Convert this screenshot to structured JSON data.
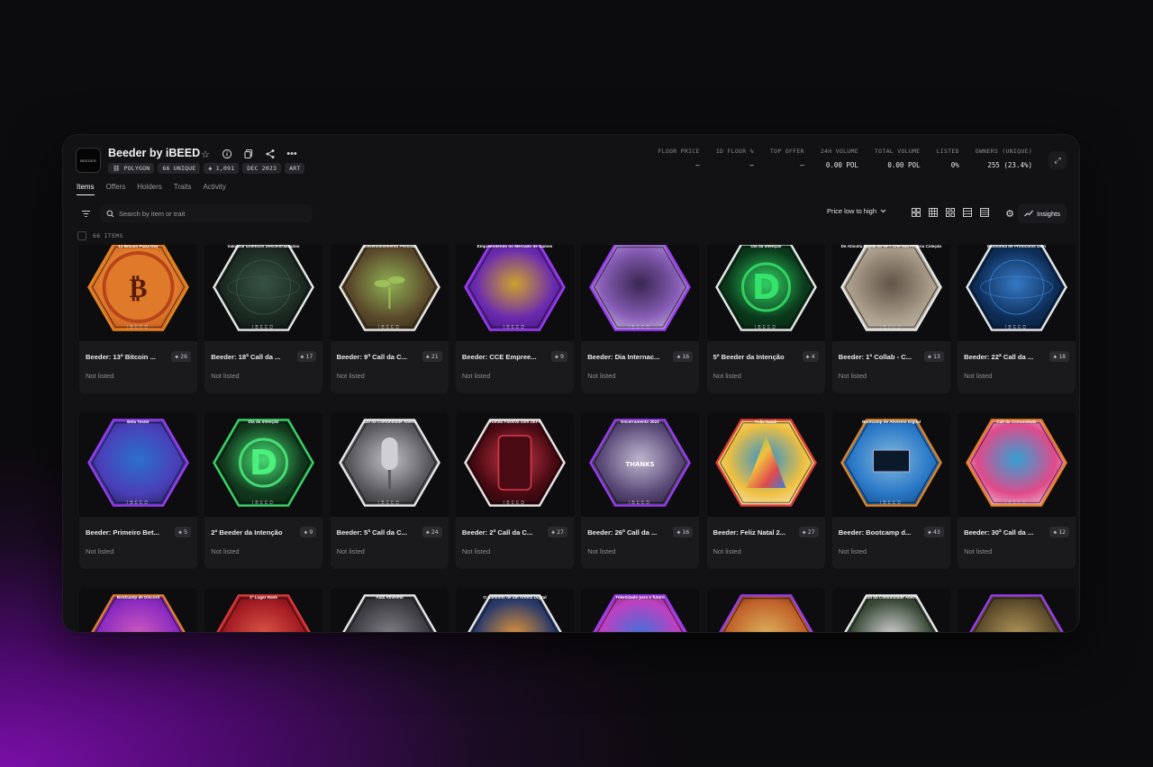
{
  "collection": {
    "logo_text": "BEEDER",
    "name": "Beeder by iBEED",
    "badges": [
      "POLYGON",
      "66 UNIQUE",
      "1,091",
      "DEC 2023",
      "ART"
    ]
  },
  "stats": [
    {
      "label": "FLOOR PRICE",
      "value": "–"
    },
    {
      "label": "1D FLOOR %",
      "value": "–"
    },
    {
      "label": "TOP OFFER",
      "value": "–"
    },
    {
      "label": "24H VOLUME",
      "value": "0.00 POL"
    },
    {
      "label": "TOTAL VOLUME",
      "value": "0.00 POL"
    },
    {
      "label": "LISTED",
      "value": "0%"
    },
    {
      "label": "OWNERS (UNIQUE)",
      "value": "255 (23.4%)"
    }
  ],
  "tabs": [
    "Items",
    "Offers",
    "Holders",
    "Traits",
    "Activity"
  ],
  "search": {
    "placeholder": "Search by item or trait"
  },
  "sort": {
    "label": "Price low to high"
  },
  "insights_label": "Insights",
  "items_count": "66 ITEMS",
  "colors": {
    "accent_purple": "#8a1cc7",
    "card_bg": "#1a1a1d",
    "window_bg": "#121214"
  },
  "items": [
    {
      "name": "Beeder: 13º Bitcoin ...",
      "qty": "26",
      "status": "Not listed",
      "hex_title": "13 Bitcoin Pizza Day",
      "hex_color": "#e3841e",
      "art": "pizza"
    },
    {
      "name": "Beeder: 18ª Call da ...",
      "qty": "17",
      "status": "Not listed",
      "hex_title": "Valorizar Estéticos Descentralizados",
      "hex_color": "#e8e8e8",
      "art": "atom"
    },
    {
      "name": "Beeder: 9ª Call da C...",
      "qty": "21",
      "status": "Not listed",
      "hex_title": "Desenvolvimento Pessoal",
      "hex_color": "#e8e8e8",
      "art": "sprout"
    },
    {
      "name": "Beeder: CCE Empree...",
      "qty": "9",
      "status": "Not listed",
      "hex_title": "Empreendendo no Mercado de Games",
      "hex_color": "#9a3cf0",
      "art": "games"
    },
    {
      "name": "Beeder: Dia Internac...",
      "qty": "16",
      "status": "Not listed",
      "hex_title": "",
      "hex_color": "#9a3cf0",
      "art": "flowers"
    },
    {
      "name": "5º Beeder da Intenção",
      "qty": "4",
      "status": "Not listed",
      "hex_title": "Dia da Intenção",
      "hex_color": "#e8e8e8",
      "art": "dgreen"
    },
    {
      "name": "Beeder: 1º Collab - C...",
      "qty": "13",
      "status": "Not listed",
      "hex_title": "De Ativista Digital ao NFT Crie sua Própria Coleção",
      "hex_color": "#e8e8e8",
      "art": "papers"
    },
    {
      "name": "Beeder: 22ª Call da ...",
      "qty": "18",
      "status": "Not listed",
      "hex_title": "Economia de Protocolos DeFi",
      "hex_color": "#e8e8e8",
      "art": "network"
    },
    {
      "name": "Beeder: Primeiro Bet...",
      "qty": "5",
      "status": "Not listed",
      "hex_title": "Beta Tester",
      "hex_color": "#9a3cf0",
      "art": "avatar"
    },
    {
      "name": "2º Beeder da Intenção",
      "qty": "9",
      "status": "Not listed",
      "hex_title": "Dia da Intenção",
      "hex_color": "#3ad46a",
      "art": "dgreen2"
    },
    {
      "name": "Beeder: 5ª Call da C...",
      "qty": "24",
      "status": "Not listed",
      "hex_title": "Call da Comunidade Aberta",
      "hex_color": "#e8e8e8",
      "art": "mic"
    },
    {
      "name": "Beeder: 2ª Call da C...",
      "qty": "27",
      "status": "Not listed",
      "hex_title": "Renda Passiva com DEFI",
      "hex_color": "#e8e8e8",
      "art": "phone"
    },
    {
      "name": "Beeder: 26ª Call da ...",
      "qty": "16",
      "status": "Not listed",
      "hex_title": "Encerramento 2023",
      "hex_color": "#9a3cf0",
      "art": "thanks"
    },
    {
      "name": "Beeder: Feliz Natal 2...",
      "qty": "27",
      "status": "Not listed",
      "hex_title": "Feliz Natal!",
      "hex_color": "#d83a3a",
      "art": "tree"
    },
    {
      "name": "Beeder: Bootcamp d...",
      "qty": "43",
      "status": "Not listed",
      "hex_title": "Bootcamp de Ativismo Digital",
      "hex_color": "#e3841e",
      "art": "desk"
    },
    {
      "name": "Beeder: 30ª Call da ...",
      "qty": "12",
      "status": "Not listed",
      "hex_title": "Call da Comunidade",
      "hex_color": "#e3841e",
      "art": "cubes"
    },
    {
      "name": "",
      "qty": "",
      "status": "",
      "hex_title": "Bootcamp de Discord",
      "hex_color": "#e3841e",
      "art": "purple"
    },
    {
      "name": "",
      "qty": "",
      "status": "",
      "hex_title": "1º Lugar Rank",
      "hex_color": "#d83a3a",
      "art": "red"
    },
    {
      "name": "",
      "qty": "",
      "status": "",
      "hex_title": "Aula Ativismo",
      "hex_color": "#e8e8e8",
      "art": "dark"
    },
    {
      "name": "",
      "qty": "",
      "status": "",
      "hex_title": "O Caminho de um Artista Digital",
      "hex_color": "#e8e8e8",
      "art": "city"
    },
    {
      "name": "",
      "qty": "",
      "status": "",
      "hex_title": "Tokenizado para o futuro",
      "hex_color": "#9a3cf0",
      "art": "pink"
    },
    {
      "name": "",
      "qty": "",
      "status": "",
      "hex_title": "",
      "hex_color": "#9a3cf0",
      "art": "hands"
    },
    {
      "name": "",
      "qty": "",
      "status": "",
      "hex_title": "Call da Comunidade Aberta",
      "hex_color": "#e8e8e8",
      "art": "plant"
    },
    {
      "name": "",
      "qty": "",
      "status": "",
      "hex_title": "",
      "hex_color": "#9a3cf0",
      "art": "clock"
    }
  ]
}
